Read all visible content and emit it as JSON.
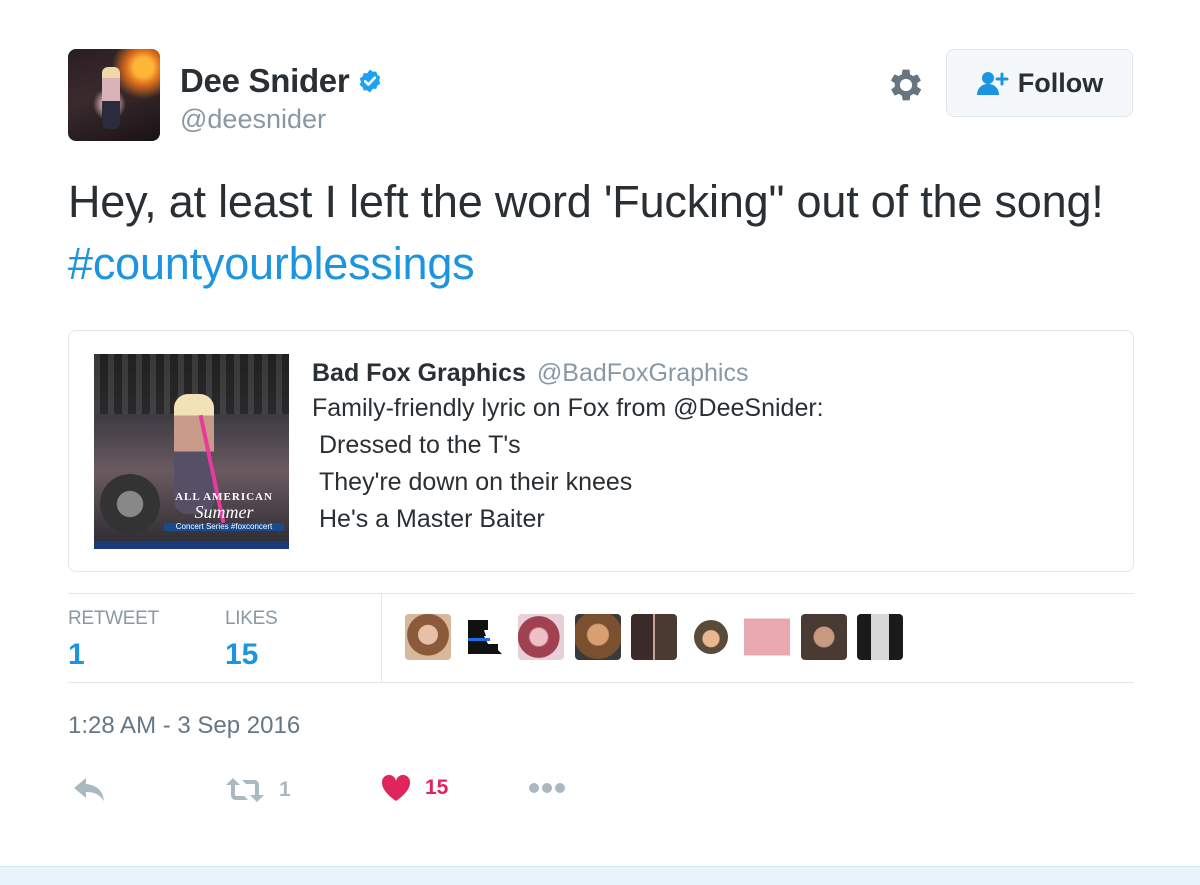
{
  "author": {
    "display_name": "Dee Snider",
    "handle": "@deesnider",
    "verified": true
  },
  "header": {
    "follow_label": "Follow",
    "settings_icon": "gear-icon",
    "follow_icon": "add-user-icon"
  },
  "tweet": {
    "text": "Hey, at least I left the word 'Fucking\" out of the song! ",
    "hashtag": "#countyourblessings"
  },
  "quoted_tweet": {
    "display_name": "Bad Fox Graphics",
    "handle": "@BadFoxGraphics",
    "lines": [
      "Family-friendly lyric on Fox from @DeeSnider:",
      "Dressed to the T's",
      "They're down on their knees",
      "He's a Master Baiter"
    ],
    "media": {
      "badge_line1": "ALL AMERICAN",
      "badge_line2": "Summer",
      "badge_line3": "Concert Series",
      "badge_tag": "#foxconcert"
    }
  },
  "stats": {
    "retweets_label": "RETWEET",
    "retweets_value": "1",
    "likes_label": "LIKES",
    "likes_value": "15",
    "liker_avatar_count": 9
  },
  "timestamp": "1:28 AM - 3 Sep 2016",
  "actions": {
    "reply_icon": "reply-icon",
    "retweet_icon": "retweet-icon",
    "retweet_count": "1",
    "like_icon": "heart-icon",
    "like_count": "15",
    "more_icon": "more-icon"
  },
  "colors": {
    "link_blue": "#1b95e0",
    "like_red": "#e0245e",
    "muted_gray": "#8899a6",
    "verified_blue": "#1da1f2"
  }
}
